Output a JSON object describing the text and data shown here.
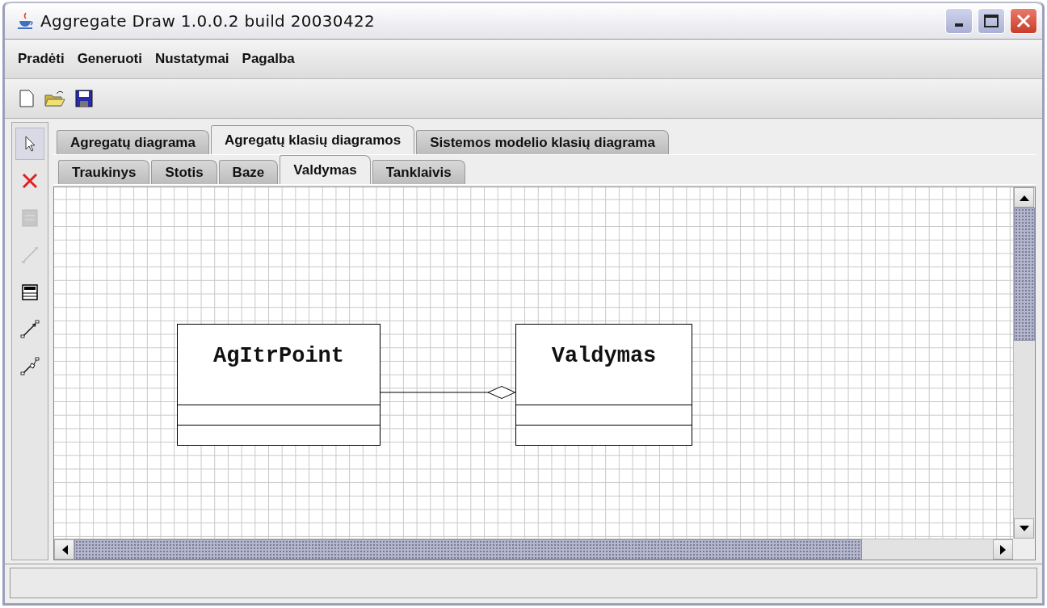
{
  "window": {
    "title": "Aggregate Draw 1.0.0.2 build 20030422"
  },
  "menu": [
    "Pradėti",
    "Generuoti",
    "Nustatymai",
    "Pagalba"
  ],
  "toolbar": [
    {
      "kind": "new"
    },
    {
      "kind": "open"
    },
    {
      "kind": "save"
    }
  ],
  "tools": [
    {
      "kind": "pointer",
      "selected": true,
      "disabled": false
    },
    {
      "kind": "delete",
      "selected": false,
      "disabled": false
    },
    {
      "kind": "class",
      "selected": false,
      "disabled": true
    },
    {
      "kind": "line",
      "selected": false,
      "disabled": true
    },
    {
      "kind": "clib",
      "selected": false,
      "disabled": false
    },
    {
      "kind": "arrow",
      "selected": false,
      "disabled": false
    },
    {
      "kind": "aggregation",
      "selected": false,
      "disabled": false
    }
  ],
  "tabs": [
    {
      "label": "Agregatų diagrama",
      "selected": false
    },
    {
      "label": "Agregatų klasių diagramos",
      "selected": true
    },
    {
      "label": "Sistemos modelio klasių diagrama",
      "selected": false
    }
  ],
  "subtabs": [
    {
      "label": "Traukinys",
      "selected": false
    },
    {
      "label": "Stotis",
      "selected": false
    },
    {
      "label": "Baze",
      "selected": false
    },
    {
      "label": "Valdymas",
      "selected": true
    },
    {
      "label": "Tanklaivis",
      "selected": false
    }
  ],
  "diagram": {
    "classes": [
      {
        "name": "AgItrPoint"
      },
      {
        "name": "Valdymas"
      }
    ],
    "connectors": [
      {
        "kind": "aggregation"
      }
    ]
  }
}
